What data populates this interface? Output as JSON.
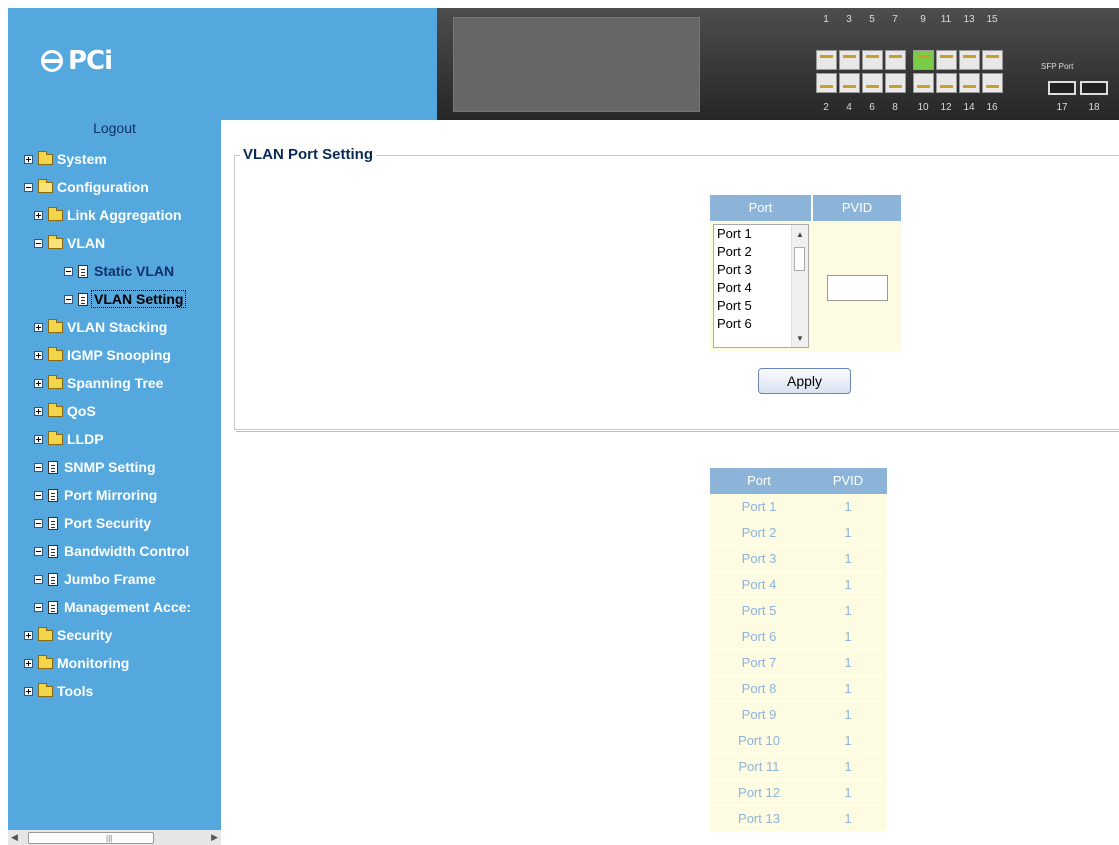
{
  "brand": {
    "logo_text": "PCi"
  },
  "sidebar": {
    "logout": "Logout",
    "tree": [
      {
        "label": "System",
        "level": 0,
        "kind": "folder",
        "expanded": false
      },
      {
        "label": "Configuration",
        "level": 0,
        "kind": "folder",
        "expanded": true
      },
      {
        "label": "Link Aggregation",
        "level": 1,
        "kind": "folder",
        "expanded": false
      },
      {
        "label": "VLAN",
        "level": 1,
        "kind": "folder",
        "expanded": true
      },
      {
        "label": "Static VLAN",
        "level": 2,
        "kind": "page"
      },
      {
        "label": "VLAN Setting",
        "level": 2,
        "kind": "page",
        "selected": true
      },
      {
        "label": "VLAN Stacking",
        "level": 1,
        "kind": "folder",
        "expanded": false
      },
      {
        "label": "IGMP Snooping",
        "level": 1,
        "kind": "folder",
        "expanded": false
      },
      {
        "label": "Spanning Tree",
        "level": 1,
        "kind": "folder",
        "expanded": false
      },
      {
        "label": "QoS",
        "level": 1,
        "kind": "folder",
        "expanded": false
      },
      {
        "label": "LLDP",
        "level": 1,
        "kind": "folder",
        "expanded": false
      },
      {
        "label": "SNMP Setting",
        "level": 1,
        "kind": "page"
      },
      {
        "label": "Port Mirroring",
        "level": 1,
        "kind": "page"
      },
      {
        "label": "Port Security",
        "level": 1,
        "kind": "page"
      },
      {
        "label": "Bandwidth Control",
        "level": 1,
        "kind": "page"
      },
      {
        "label": "Jumbo Frame",
        "level": 1,
        "kind": "page"
      },
      {
        "label": "Management Acce:",
        "level": 1,
        "kind": "page"
      },
      {
        "label": "Security",
        "level": 0,
        "kind": "folder",
        "expanded": false
      },
      {
        "label": "Monitoring",
        "level": 0,
        "kind": "folder",
        "expanded": false
      },
      {
        "label": "Tools",
        "level": 0,
        "kind": "folder",
        "expanded": false
      }
    ]
  },
  "switch_panel": {
    "top_port_numbers": [
      "1",
      "3",
      "5",
      "7",
      "9",
      "11",
      "13",
      "15"
    ],
    "bottom_port_numbers": [
      "2",
      "4",
      "6",
      "8",
      "10",
      "12",
      "14",
      "16"
    ],
    "active_port": "9",
    "sfp_label": "SFP Port",
    "sfp_port_numbers": [
      "17",
      "18"
    ]
  },
  "main": {
    "section_title": "VLAN Port Setting",
    "form": {
      "col_port": "Port",
      "col_pvid": "PVID",
      "port_options": [
        "Port 1",
        "Port 2",
        "Port 3",
        "Port 4",
        "Port 5",
        "Port 6"
      ],
      "pvid_value": "",
      "apply_label": "Apply"
    },
    "status_table": {
      "col_port": "Port",
      "col_pvid": "PVID",
      "rows": [
        {
          "port": "Port 1",
          "pvid": "1"
        },
        {
          "port": "Port 2",
          "pvid": "1"
        },
        {
          "port": "Port 3",
          "pvid": "1"
        },
        {
          "port": "Port 4",
          "pvid": "1"
        },
        {
          "port": "Port 5",
          "pvid": "1"
        },
        {
          "port": "Port 6",
          "pvid": "1"
        },
        {
          "port": "Port 7",
          "pvid": "1"
        },
        {
          "port": "Port 8",
          "pvid": "1"
        },
        {
          "port": "Port 9",
          "pvid": "1"
        },
        {
          "port": "Port 10",
          "pvid": "1"
        },
        {
          "port": "Port 11",
          "pvid": "1"
        },
        {
          "port": "Port 12",
          "pvid": "1"
        },
        {
          "port": "Port 13",
          "pvid": "1"
        }
      ]
    }
  }
}
